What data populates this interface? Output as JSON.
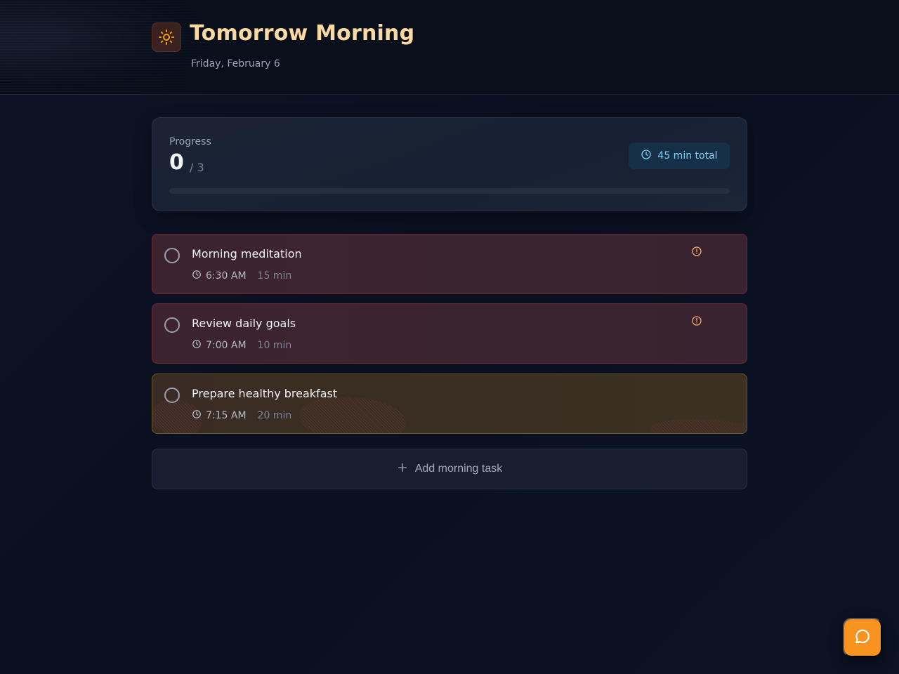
{
  "header": {
    "title": "Tomorrow Morning",
    "date": "Friday, February 6",
    "icon": "sun-icon"
  },
  "progress": {
    "label": "Progress",
    "completed": "0",
    "total_text": "/ 3",
    "completed_fraction": 0,
    "badge_text": "45 min total",
    "badge_icon": "clock-icon"
  },
  "tasks": [
    {
      "title": "Morning meditation",
      "time": "6:30 AM",
      "duration": "15 min",
      "status": "pending",
      "priority": "high",
      "alert_icon": "alert-circle-icon"
    },
    {
      "title": "Review daily goals",
      "time": "7:00 AM",
      "duration": "10 min",
      "status": "pending",
      "priority": "high",
      "alert_icon": "alert-circle-icon"
    },
    {
      "title": "Prepare healthy breakfast",
      "time": "7:15 AM",
      "duration": "20 min",
      "status": "pending",
      "priority": "medium"
    }
  ],
  "add_task": {
    "label": "Add morning task",
    "icon": "plus-icon"
  },
  "fab": {
    "icon": "chat-bubble-icon"
  },
  "colors": {
    "accent": "#f7931e",
    "title": "#fcd9a0",
    "badge_text": "#7ed3f2",
    "high_priority_border": "#6b2c36",
    "medium_priority_border": "#6b5a22"
  }
}
